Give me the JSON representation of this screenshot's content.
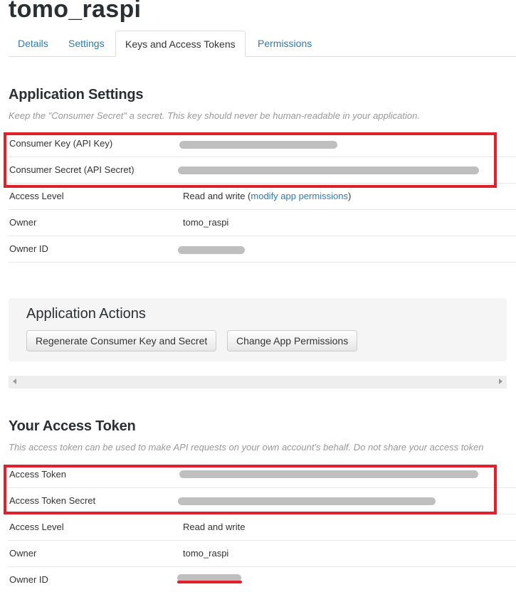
{
  "app": {
    "title": "tomo_raspi"
  },
  "tabs": [
    {
      "label": "Details"
    },
    {
      "label": "Settings"
    },
    {
      "label": "Keys and Access Tokens"
    },
    {
      "label": "Permissions"
    }
  ],
  "app_settings": {
    "title": "Application Settings",
    "description": "Keep the \"Consumer Secret\" a secret. This key should never be human-readable in your application.",
    "consumer_key_label": "Consumer Key (API Key)",
    "consumer_secret_label": "Consumer Secret (API Secret)",
    "access_level_label": "Access Level",
    "access_level_value": "Read and write (",
    "modify_link": "modify app permissions",
    "access_level_suffix": ")",
    "owner_label": "Owner",
    "owner_value": "tomo_raspi",
    "owner_id_label": "Owner ID"
  },
  "app_actions": {
    "title": "Application Actions",
    "regenerate_label": "Regenerate Consumer Key and Secret",
    "change_permissions_label": "Change App Permissions"
  },
  "access_token": {
    "title": "Your Access Token",
    "description": "This access token can be used to make API requests on your own account's behalf. Do not share your access token",
    "token_label": "Access Token",
    "token_secret_label": "Access Token Secret",
    "access_level_label": "Access Level",
    "access_level_value": "Read and write",
    "owner_label": "Owner",
    "owner_value": "tomo_raspi",
    "owner_id_label": "Owner ID"
  },
  "colors": {
    "link": "#2b7bb9",
    "highlight": "#e2202c",
    "redacted": "#bfbfbf"
  }
}
